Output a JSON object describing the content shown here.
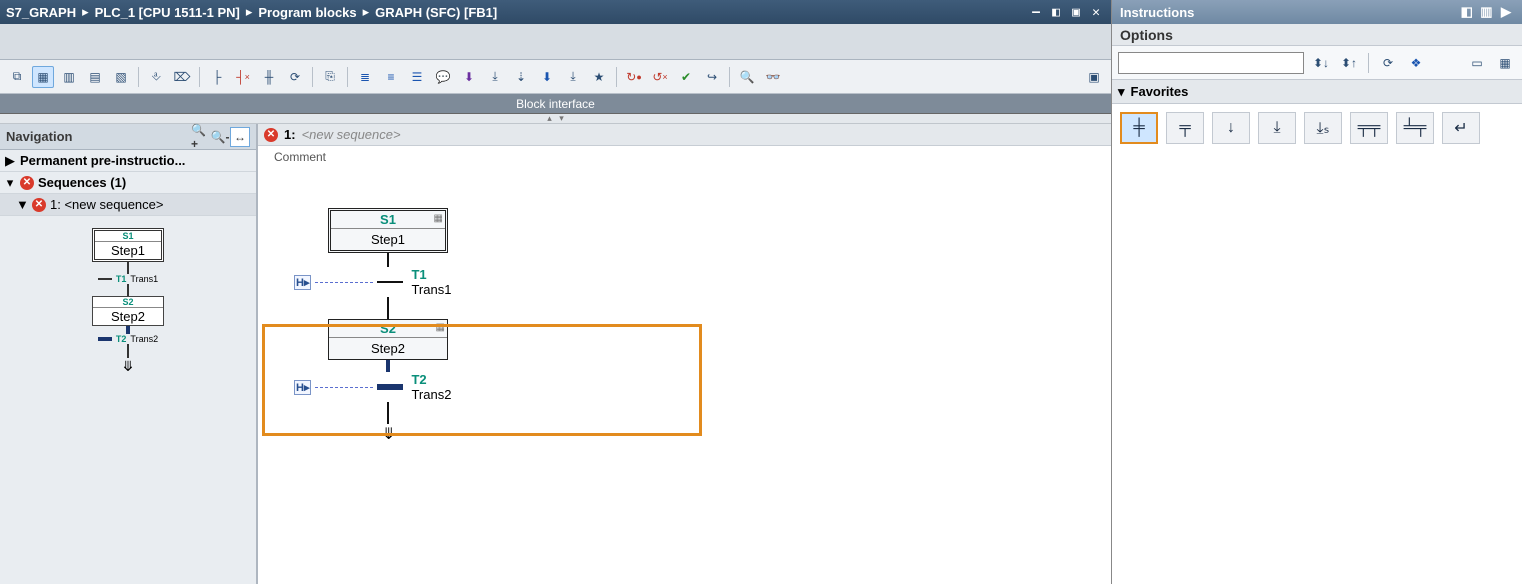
{
  "breadcrumb": [
    "S7_GRAPH",
    "PLC_1 [CPU 1511-1 PN]",
    "Program blocks",
    "GRAPH (SFC) [FB1]"
  ],
  "block_interface_label": "Block interface",
  "nav": {
    "title": "Navigation",
    "perm_pre": "Permanent pre-instructio...",
    "sequences_label": "Sequences (1)",
    "seq_item": "1: <new sequence>"
  },
  "mini": {
    "s1_id": "S1",
    "s1_name": "Step1",
    "t1_id": "T1",
    "t1_name": "Trans1",
    "s2_id": "S2",
    "s2_name": "Step2",
    "t2_id": "T2",
    "t2_name": "Trans2"
  },
  "canvas_head": {
    "num": "1:",
    "placeholder": "<new sequence>",
    "comment": "Comment"
  },
  "canvas": {
    "s1_id": "S1",
    "s1_name": "Step1",
    "t1_id": "T1",
    "t1_name": "Trans1",
    "s2_id": "S2",
    "s2_name": "Step2",
    "t2_id": "T2",
    "t2_name": "Trans2"
  },
  "side": {
    "title": "Instructions",
    "options": "Options",
    "favorites": "Favorites",
    "search_placeholder": ""
  }
}
